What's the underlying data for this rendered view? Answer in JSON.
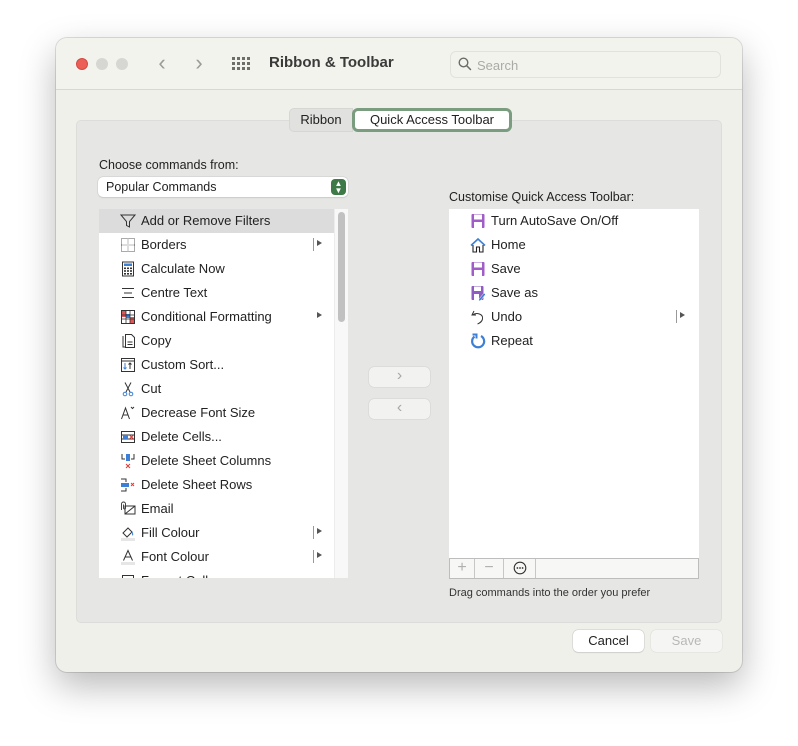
{
  "window": {
    "title": "Ribbon & Toolbar",
    "search_placeholder": "Search"
  },
  "tabs": [
    {
      "label": "Ribbon",
      "selected": false
    },
    {
      "label": "Quick Access Toolbar",
      "selected": true
    }
  ],
  "left_panel": {
    "label": "Choose commands from:",
    "dropdown_value": "Popular Commands",
    "items": [
      {
        "label": "Add or Remove Filters",
        "icon": "filter-icon",
        "selected": true,
        "submenu": false,
        "split": false
      },
      {
        "label": "Borders",
        "icon": "borders-icon",
        "selected": false,
        "submenu": true,
        "split": true
      },
      {
        "label": "Calculate Now",
        "icon": "calculator-icon",
        "selected": false,
        "submenu": false,
        "split": false
      },
      {
        "label": "Centre Text",
        "icon": "align-center-icon",
        "selected": false,
        "submenu": false,
        "split": false
      },
      {
        "label": "Conditional Formatting",
        "icon": "conditional-formatting-icon",
        "selected": false,
        "submenu": true,
        "split": false
      },
      {
        "label": "Copy",
        "icon": "copy-icon",
        "selected": false,
        "submenu": false,
        "split": false
      },
      {
        "label": "Custom Sort...",
        "icon": "sort-icon",
        "selected": false,
        "submenu": false,
        "split": false
      },
      {
        "label": "Cut",
        "icon": "scissors-icon",
        "selected": false,
        "submenu": false,
        "split": false
      },
      {
        "label": "Decrease Font Size",
        "icon": "decrease-font-icon",
        "selected": false,
        "submenu": false,
        "split": false
      },
      {
        "label": "Delete Cells...",
        "icon": "delete-cells-icon",
        "selected": false,
        "submenu": false,
        "split": false
      },
      {
        "label": "Delete Sheet Columns",
        "icon": "delete-columns-icon",
        "selected": false,
        "submenu": false,
        "split": false
      },
      {
        "label": "Delete Sheet Rows",
        "icon": "delete-rows-icon",
        "selected": false,
        "submenu": false,
        "split": false
      },
      {
        "label": "Email",
        "icon": "email-icon",
        "selected": false,
        "submenu": false,
        "split": false
      },
      {
        "label": "Fill Colour",
        "icon": "fill-colour-icon",
        "selected": false,
        "submenu": true,
        "split": true
      },
      {
        "label": "Font Colour",
        "icon": "font-colour-icon",
        "selected": false,
        "submenu": true,
        "split": true
      },
      {
        "label": "Format Cells",
        "icon": "format-cells-icon",
        "selected": false,
        "submenu": false,
        "split": false
      }
    ]
  },
  "right_panel": {
    "label": "Customise Quick Access Toolbar:",
    "items": [
      {
        "label": "Turn AutoSave On/Off",
        "icon": "autosave-icon",
        "submenu": false,
        "split": false
      },
      {
        "label": "Home",
        "icon": "home-icon",
        "submenu": false,
        "split": false
      },
      {
        "label": "Save",
        "icon": "save-icon",
        "submenu": false,
        "split": false
      },
      {
        "label": "Save as",
        "icon": "save-as-icon",
        "submenu": false,
        "split": false
      },
      {
        "label": "Undo",
        "icon": "undo-icon",
        "submenu": true,
        "split": true
      },
      {
        "label": "Repeat",
        "icon": "repeat-icon",
        "submenu": false,
        "split": false
      }
    ],
    "bar": {
      "add": "+",
      "remove": "−",
      "more": "⋯"
    },
    "hint": "Drag commands into the order you prefer"
  },
  "transfer": {
    "add": "›",
    "remove": "‹"
  },
  "footer": {
    "cancel": "Cancel",
    "save": "Save"
  },
  "colors": {
    "accent_tab_border": "#7b9d7f",
    "dropdown_stepper": "#3e7a47",
    "close_button": "#ec5f57"
  }
}
